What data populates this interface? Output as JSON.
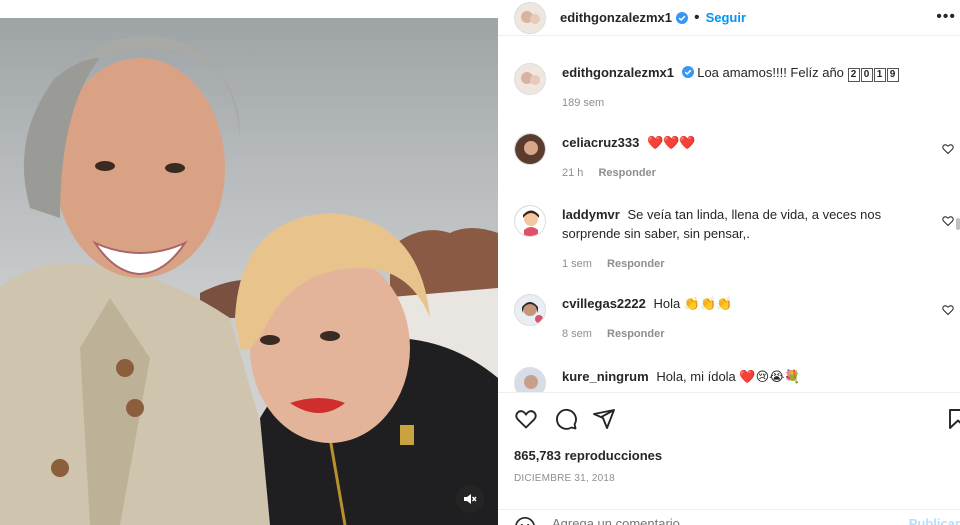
{
  "post": {
    "author": "edithgonzalezmx1",
    "follow_label": "Seguir",
    "caption": "Loa amamos!!!! Felíz año",
    "caption_year_digits": [
      "2",
      "0",
      "1",
      "9"
    ],
    "caption_time": "189 sem"
  },
  "comments": [
    {
      "user": "celiacruz333",
      "text": "❤️❤️❤️",
      "time": "21 h",
      "reply": "Responder"
    },
    {
      "user": "laddymvr",
      "text": "Se veía tan linda, llena de vida, a veces nos sorprende sin saber, sin pensar,.",
      "time": "1 sem",
      "reply": "Responder"
    },
    {
      "user": "cvillegas2222",
      "text": "Hola 👏👏👏",
      "time": "8 sem",
      "reply": "Responder"
    },
    {
      "user": "kure_ningrum",
      "text": "Hola, mi ídola ❤️😢😭💐",
      "time": "",
      "reply": ""
    }
  ],
  "stats": {
    "views": "865,783 reproducciones",
    "date": "DICIEMBRE 31, 2018"
  },
  "add_comment": {
    "placeholder": "Agrega un comentario...",
    "publish_label": "Publicar"
  },
  "colors": {
    "accent": "#0095f6",
    "muted": "#8e8e8e",
    "verified": "#3897f0",
    "heart": "#ed4956"
  },
  "icons": [
    "heart-icon",
    "comment-icon",
    "share-icon",
    "bookmark-icon",
    "mute-icon",
    "more-icon",
    "emoji-icon",
    "verified-badge-icon"
  ]
}
